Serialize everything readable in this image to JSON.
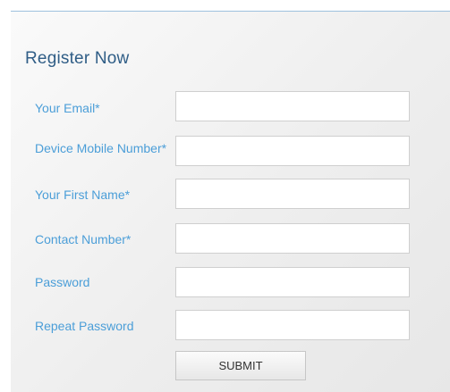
{
  "form": {
    "title": "Register Now",
    "fields": [
      {
        "label": "Your Email*",
        "value": "",
        "placeholder": ""
      },
      {
        "label": "Device Mobile Number*",
        "value": "",
        "placeholder": ""
      },
      {
        "label": "Your First Name*",
        "value": "",
        "placeholder": ""
      },
      {
        "label": "Contact Number*",
        "value": "",
        "placeholder": ""
      },
      {
        "label": "Password",
        "value": "",
        "placeholder": ""
      },
      {
        "label": "Repeat Password",
        "value": "",
        "placeholder": ""
      }
    ],
    "submit_label": "SUBMIT"
  },
  "colors": {
    "title": "#2f5d86",
    "label": "#4b9ed8",
    "panel_top_border": "#9ec1de"
  }
}
